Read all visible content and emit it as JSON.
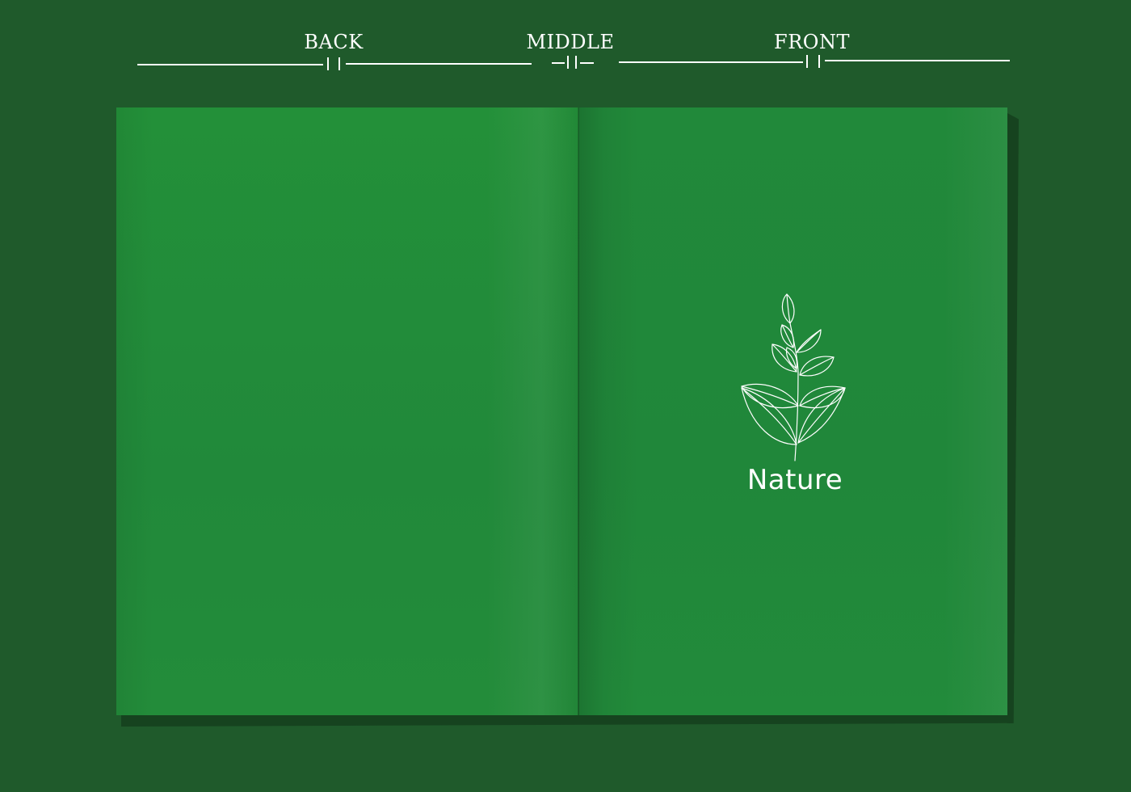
{
  "guides": {
    "back_label": "BACK",
    "middle_label": "MIDDLE",
    "front_label": "FRONT"
  },
  "cover": {
    "brand_name": "Nature",
    "logo_icon": "leaf-branch-icon"
  },
  "colors": {
    "background": "#1f5a2b",
    "page_green": "#21893a",
    "line_art": "#ffffff"
  }
}
